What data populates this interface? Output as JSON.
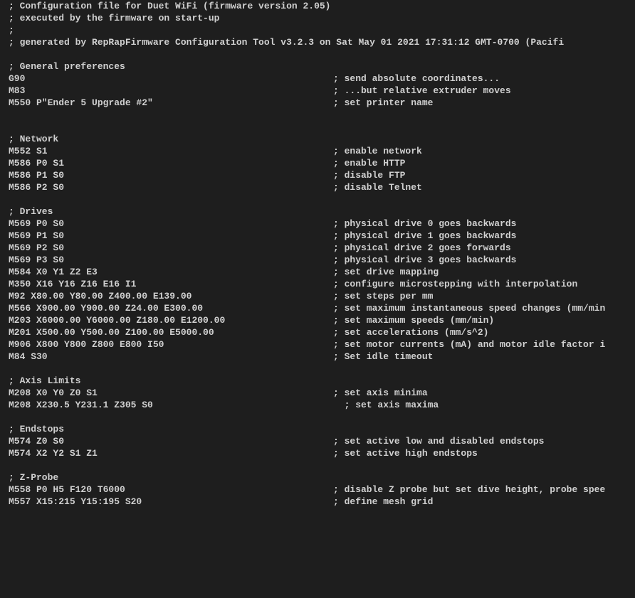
{
  "lines": [
    {
      "text": "; Configuration file for Duet WiFi (firmware version 2.05)"
    },
    {
      "text": "; executed by the firmware on start-up"
    },
    {
      "text": ";"
    },
    {
      "text": "; generated by RepRapFirmware Configuration Tool v3.2.3 on Sat May 01 2021 17:31:12 GMT-0700 (Pacifi"
    },
    {
      "text": ""
    },
    {
      "text": "; General preferences"
    },
    {
      "cmd": "G90",
      "comment": "; send absolute coordinates..."
    },
    {
      "cmd": "M83",
      "comment": "; ...but relative extruder moves"
    },
    {
      "cmd": "M550 P\"Ender 5 Upgrade #2\"",
      "comment": "; set printer name"
    },
    {
      "text": ""
    },
    {
      "text": ""
    },
    {
      "text": "; Network"
    },
    {
      "cmd": "M552 S1",
      "comment": "; enable network"
    },
    {
      "cmd": "M586 P0 S1",
      "comment": "; enable HTTP"
    },
    {
      "cmd": "M586 P1 S0",
      "comment": "; disable FTP"
    },
    {
      "cmd": "M586 P2 S0",
      "comment": "; disable Telnet"
    },
    {
      "text": ""
    },
    {
      "text": "; Drives"
    },
    {
      "cmd": "M569 P0 S0",
      "comment": "; physical drive 0 goes backwards"
    },
    {
      "cmd": "M569 P1 S0",
      "comment": "; physical drive 1 goes backwards"
    },
    {
      "cmd": "M569 P2 S0",
      "comment": "; physical drive 2 goes forwards"
    },
    {
      "cmd": "M569 P3 S0",
      "comment": "; physical drive 3 goes backwards"
    },
    {
      "cmd": "M584 X0 Y1 Z2 E3",
      "comment": "; set drive mapping"
    },
    {
      "cmd": "M350 X16 Y16 Z16 E16 I1",
      "comment": "; configure microstepping with interpolation"
    },
    {
      "cmd": "M92 X80.00 Y80.00 Z400.00 E139.00",
      "comment": "; set steps per mm"
    },
    {
      "cmd": "M566 X900.00 Y900.00 Z24.00 E300.00",
      "comment": "; set maximum instantaneous speed changes (mm/min"
    },
    {
      "cmd": "M203 X6000.00 Y6000.00 Z180.00 E1200.00",
      "comment": "; set maximum speeds (mm/min)"
    },
    {
      "cmd": "M201 X500.00 Y500.00 Z100.00 E5000.00",
      "comment": "; set accelerations (mm/s^2)"
    },
    {
      "cmd": "M906 X800 Y800 Z800 E800 I50",
      "comment": "; set motor currents (mA) and motor idle factor i"
    },
    {
      "cmd": "M84 S30",
      "comment": "; Set idle timeout"
    },
    {
      "text": ""
    },
    {
      "text": "; Axis Limits"
    },
    {
      "cmd": "M208 X0 Y0 Z0 S1",
      "comment": "; set axis minima"
    },
    {
      "cmd": "M208 X230.5 Y231.1 Z305 S0",
      "comment": "  ; set axis maxima"
    },
    {
      "text": ""
    },
    {
      "text": "; Endstops"
    },
    {
      "cmd": "M574 Z0 S0",
      "comment": "; set active low and disabled endstops"
    },
    {
      "cmd": "M574 X2 Y2 S1 Z1",
      "comment": "; set active high endstops"
    },
    {
      "text": ""
    },
    {
      "text": "; Z-Probe"
    },
    {
      "cmd": "M558 P0 H5 F120 T6000",
      "comment": "; disable Z probe but set dive height, probe spee"
    },
    {
      "cmd": "M557 X15:215 Y15:195 S20",
      "comment": "; define mesh grid"
    }
  ]
}
